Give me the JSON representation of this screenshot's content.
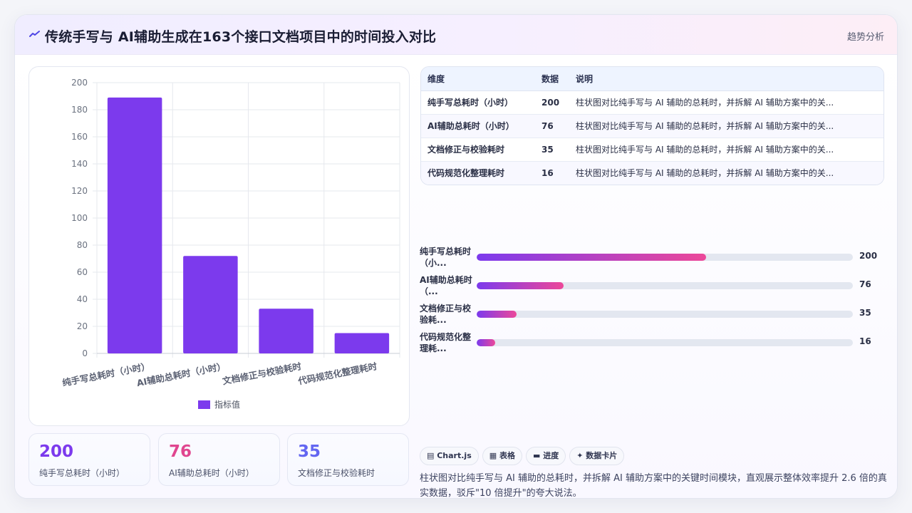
{
  "header": {
    "title": "传统手写与 AI辅助生成在163个接口文档项目中的时间投入对比",
    "tag": "趋势分析"
  },
  "chart_data": {
    "type": "bar",
    "categories": [
      "纯手写总耗时（小时）",
      "AI辅助总耗时（小时）",
      "文档修正与校验耗时",
      "代码规范化整理耗时"
    ],
    "series": [
      {
        "name": "指标值",
        "values": [
          189,
          72,
          33,
          15
        ]
      }
    ],
    "ylim": [
      0,
      200
    ],
    "yticks": [
      0,
      20,
      40,
      60,
      80,
      100,
      120,
      140,
      160,
      180,
      200
    ],
    "grid": true,
    "legend_position": "bottom",
    "bar_color": "#7c3aed"
  },
  "stats": [
    {
      "value": "200",
      "label": "纯手写总耗时（小时）",
      "color": "#7c3aed"
    },
    {
      "value": "76",
      "label": "AI辅助总耗时（小时）",
      "color": "#e0468f"
    },
    {
      "value": "35",
      "label": "文档修正与校验耗时",
      "color": "#6366f1"
    }
  ],
  "table": {
    "headers": [
      "维度",
      "数据",
      "说明"
    ],
    "rows": [
      [
        "纯手写总耗时（小时）",
        "200",
        "柱状图对比纯手写与 AI 辅助的总耗时，并拆解 AI 辅助方案中的关..."
      ],
      [
        "AI辅助总耗时（小时）",
        "76",
        "柱状图对比纯手写与 AI 辅助的总耗时，并拆解 AI 辅助方案中的关..."
      ],
      [
        "文档修正与校验耗时",
        "35",
        "柱状图对比纯手写与 AI 辅助的总耗时，并拆解 AI 辅助方案中的关..."
      ],
      [
        "代码规范化整理耗时",
        "16",
        "柱状图对比纯手写与 AI 辅助的总耗时，并拆解 AI 辅助方案中的关..."
      ]
    ]
  },
  "progress": {
    "max": 328,
    "items": [
      {
        "label": "纯手写总耗时（小...",
        "value": 200
      },
      {
        "label": "AI辅助总耗时（...",
        "value": 76
      },
      {
        "label": "文档修正与校验耗...",
        "value": 35
      },
      {
        "label": "代码规范化整理耗...",
        "value": 16
      }
    ]
  },
  "chips": [
    {
      "icon": "chart-icon",
      "glyph": "▤",
      "label": "Chart.js"
    },
    {
      "icon": "table-icon",
      "glyph": "▦",
      "label": "表格"
    },
    {
      "icon": "progress-icon",
      "glyph": "▬",
      "label": "进度"
    },
    {
      "icon": "sparkle-icon",
      "glyph": "✦",
      "label": "数据卡片"
    }
  ],
  "description": "柱状图对比纯手写与 AI 辅助的总耗时，并拆解 AI 辅助方案中的关键时间模块，直观展示整体效率提升 2.6 倍的真实数据，驳斥\"10 倍提升\"的夸大说法。"
}
